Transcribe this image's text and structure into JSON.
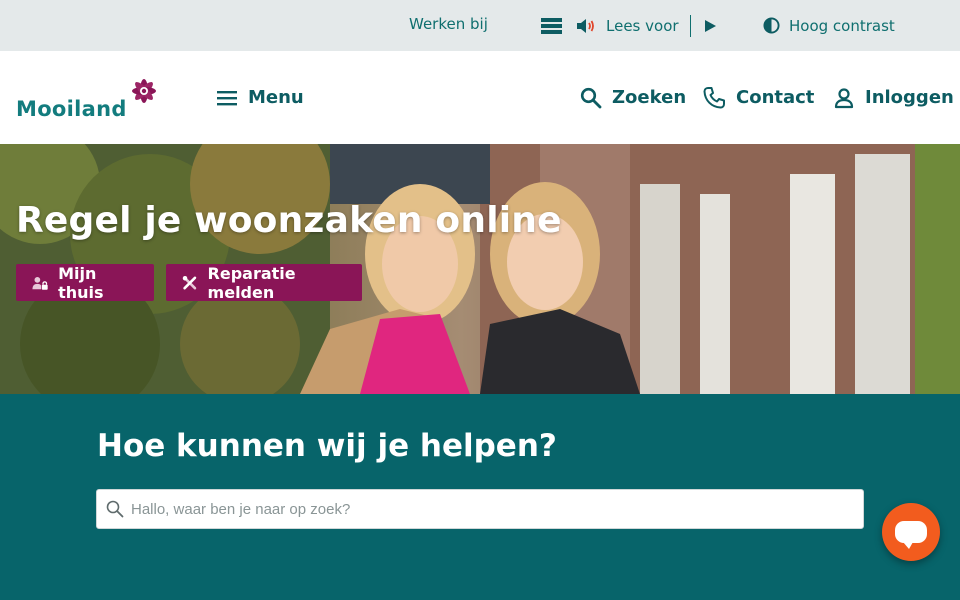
{
  "utility": {
    "werken_bij": "Werken bij",
    "lees_voor": "Lees voor",
    "hoog_contrast": "Hoog contrast"
  },
  "header": {
    "logo_text": "Mooiland",
    "menu_label": "Menu",
    "search_label": "Zoeken",
    "contact_label": "Contact",
    "login_label": "Inloggen"
  },
  "hero": {
    "title": "Regel je woonzaken online",
    "buttons": [
      {
        "label": "Mijn thuis",
        "icon": "user-lock-icon"
      },
      {
        "label": "Reparatie melden",
        "icon": "tools-icon"
      }
    ]
  },
  "help": {
    "title": "Hoe kunnen wij je helpen?",
    "search_placeholder": "Hallo, waar ben je naar op zoek?"
  },
  "colors": {
    "teal_dark": "#07646a",
    "teal_text": "#0d5c62",
    "magenta": "#8a1557",
    "chat_orange": "#f25c1e",
    "utility_bg": "#e4e9ea"
  }
}
